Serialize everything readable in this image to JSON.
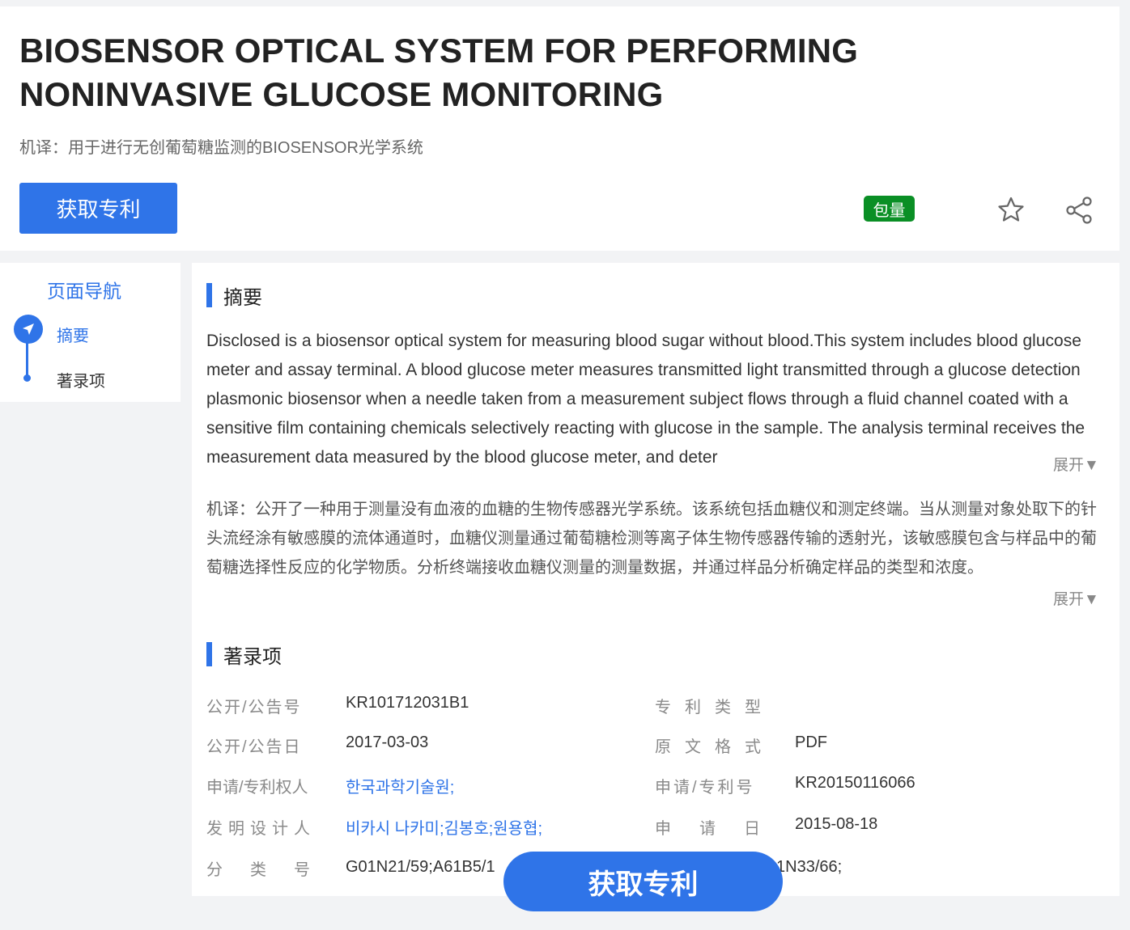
{
  "header": {
    "title": "BIOSENSOR OPTICAL SYSTEM FOR PERFORMING NONINVASIVE GLUCOSE MONITORING",
    "machine_translation": "机译：用于进行无创葡萄糖监测的BIOSENSOR光学系统",
    "get_patent_label": "获取专利",
    "badge_label": "包量",
    "icons": {
      "favorite": "star-icon",
      "share": "share-icon"
    }
  },
  "nav": {
    "title": "页面导航",
    "items": [
      {
        "label": "摘要",
        "active": true
      },
      {
        "label": "著录项",
        "active": false
      }
    ]
  },
  "abstract": {
    "heading": "摘要",
    "english": "Disclosed is a biosensor optical system for measuring blood sugar without blood.This system includes blood glucose meter and assay terminal. A blood glucose meter measures transmitted light transmitted through a glucose detection plasmonic biosensor when a needle taken from a measurement subject flows through a fluid channel coated with a sensitive film containing chemicals selectively reacting with glucose in the sample. The analysis terminal receives the measurement data measured by the blood glucose meter, and deter",
    "chinese": "机译：公开了一种用于测量没有血液的血糖的生物传感器光学系统。该系统包括血糖仪和测定终端。当从测量对象处取下的针头流经涂有敏感膜的流体通道时，血糖仪测量通过葡萄糖检测等离子体生物传感器传输的透射光，该敏感膜包含与样品中的葡萄糖选择性反应的化学物质。分析终端接收血糖仪测量的测量数据，并通过样品分析确定样品的类型和浓度。",
    "expand_label": "展开▼"
  },
  "biblio": {
    "heading": "著录项",
    "left": [
      {
        "label": "公开/公告号",
        "value": "KR101712031B1",
        "link": false
      },
      {
        "label": "公开/公告日",
        "value": "2017-03-03",
        "link": false
      },
      {
        "label": "申请/专利权人",
        "value": "한국과학기술원;",
        "link": true
      },
      {
        "label": "发明设计人",
        "value": "비카시 나카미;김봉호;원용협;",
        "link": true
      },
      {
        "label": "分类号",
        "value": "G01N21/59;A61B5/1",
        "link": false
      }
    ],
    "right": [
      {
        "label": "专利类型",
        "value": ""
      },
      {
        "label": "原文格式",
        "value": "PDF"
      },
      {
        "label": "申请/专利号",
        "value": "KR20150116066"
      },
      {
        "label": "申请日",
        "value": "2015-08-18"
      },
      {
        "label": "",
        "value": "1N33/66;"
      }
    ]
  },
  "floating": {
    "get_patent_label": "获取专利"
  },
  "colors": {
    "accent": "#2f74e8",
    "badge": "#0a8f25"
  }
}
